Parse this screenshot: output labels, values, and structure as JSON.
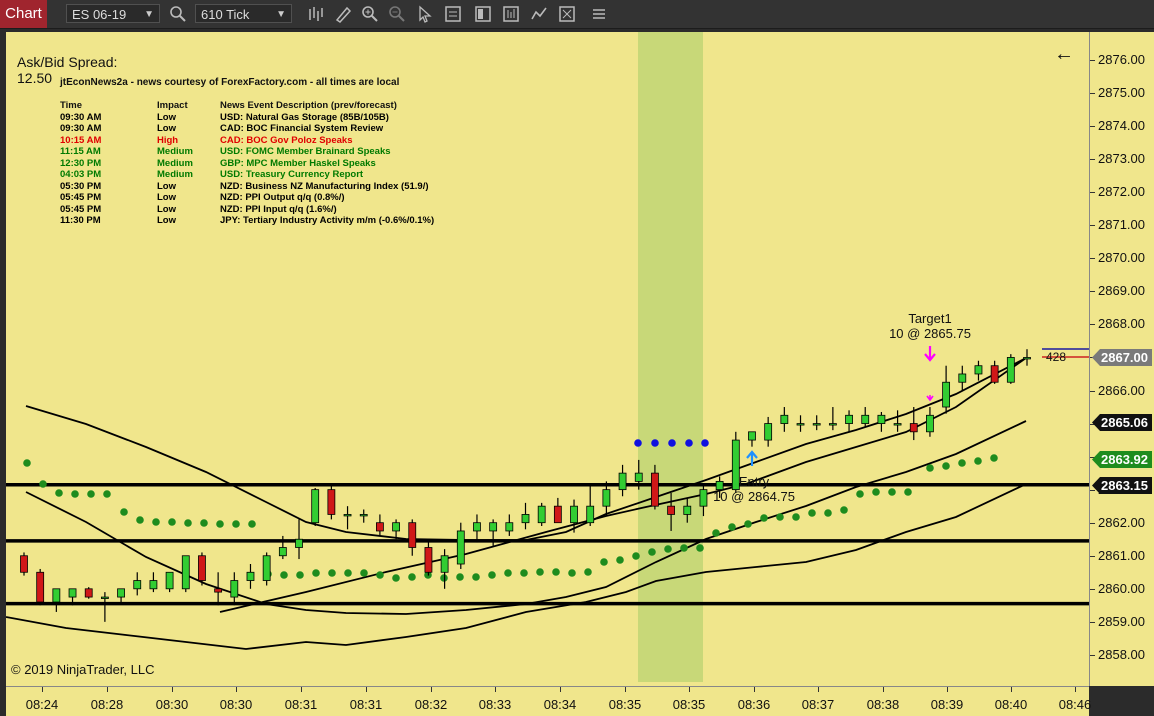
{
  "toolbar": {
    "tab_label": "Chart",
    "instrument": "ES 06-19",
    "interval": "610 Tick"
  },
  "spread": {
    "label": "Ask/Bid Spread:",
    "value": "12.50"
  },
  "news": {
    "title": "jtEconNews2a - news courtesy of ForexFactory.com - all times are local",
    "headers": [
      "Time",
      "Impact",
      "News Event Description (prev/forecast)"
    ],
    "rows": [
      {
        "time": "09:30 AM",
        "impact": "Low",
        "desc": "USD: Natural Gas Storage (85B/105B)",
        "color": "#000000"
      },
      {
        "time": "09:30 AM",
        "impact": "Low",
        "desc": "CAD: BOC Financial System Review",
        "color": "#000000"
      },
      {
        "time": "10:15 AM",
        "impact": "High",
        "desc": "CAD: BOC Gov Poloz Speaks",
        "color": "#e00000"
      },
      {
        "time": "11:15 AM",
        "impact": "Medium",
        "desc": "USD: FOMC Member Brainard Speaks",
        "color": "#007a00"
      },
      {
        "time": "12:30 PM",
        "impact": "Medium",
        "desc": "GBP: MPC Member Haskel Speaks",
        "color": "#007a00"
      },
      {
        "time": "04:03 PM",
        "impact": "Medium",
        "desc": "USD: Treasury Currency Report",
        "color": "#007a00"
      },
      {
        "time": "05:30 PM",
        "impact": "Low",
        "desc": "NZD: Business NZ Manufacturing Index (51.9/)",
        "color": "#000000"
      },
      {
        "time": "05:45 PM",
        "impact": "Low",
        "desc": "NZD: PPI Output q/q (0.8%/)",
        "color": "#000000"
      },
      {
        "time": "05:45 PM",
        "impact": "Low",
        "desc": "NZD: PPI Input q/q (1.6%/)",
        "color": "#000000"
      },
      {
        "time": "11:30 PM",
        "impact": "Low",
        "desc": "JPY: Tertiary Industry Activity m/m (-0.6%/0.1%)",
        "color": "#000000"
      }
    ]
  },
  "copyright": "© 2019 NinjaTrader, LLC",
  "annotations": {
    "target_label": "Target1",
    "target_detail": "10 @ 2865.75",
    "entry_label": "Entry",
    "entry_detail": "10 @ 2864.75",
    "position_qty": "428"
  },
  "price_axis": {
    "labels": [
      "2876.00",
      "2875.00",
      "2874.00",
      "2873.00",
      "2872.00",
      "2871.00",
      "2870.00",
      "2869.00",
      "2868.00",
      "2867.00",
      "2866.00",
      "2865.00",
      "2864.00",
      "2863.00",
      "2862.00",
      "2861.00",
      "2860.00",
      "2859.00",
      "2858.00"
    ],
    "boxes": [
      {
        "value": "2867.00",
        "bg": "#7a7a7a",
        "fg": "#ffffff"
      },
      {
        "value": "2865.06",
        "bg": "#111111",
        "fg": "#ffffff"
      },
      {
        "value": "2863.92",
        "bg": "#1e8c1e",
        "fg": "#ffffff"
      },
      {
        "value": "2863.15",
        "bg": "#111111",
        "fg": "#ffffff"
      }
    ]
  },
  "time_axis": {
    "labels": [
      "08:24",
      "08:28",
      "08:30",
      "08:30",
      "08:31",
      "08:31",
      "08:32",
      "08:33",
      "08:34",
      "08:35",
      "08:35",
      "08:36",
      "08:37",
      "08:38",
      "08:39",
      "08:40",
      "08:46"
    ]
  },
  "colors": {
    "background": "#f0e68c",
    "bull_candle": "#32cd32",
    "bear_candle": "#d01818",
    "dots": "#1e8c1e",
    "blue_dots": "#1010e0",
    "highlight": "#c8d878",
    "tab": "#a0252e"
  },
  "chart_data": {
    "type": "candlestick",
    "instrument": "ES 06-19",
    "interval": "610 Tick",
    "horizontal_lines": [
      2863.15,
      2861.45,
      2859.55
    ],
    "candles": [
      {
        "o": 2861.0,
        "h": 2861.1,
        "l": 2860.4,
        "c": 2860.5
      },
      {
        "o": 2860.5,
        "h": 2860.6,
        "l": 2859.5,
        "c": 2859.6
      },
      {
        "o": 2859.6,
        "h": 2860.0,
        "l": 2859.3,
        "c": 2860.0
      },
      {
        "o": 2859.75,
        "h": 2860.0,
        "l": 2859.5,
        "c": 2860.0
      },
      {
        "o": 2860.0,
        "h": 2860.05,
        "l": 2859.7,
        "c": 2859.75
      },
      {
        "o": 2859.75,
        "h": 2859.9,
        "l": 2859.0,
        "c": 2859.75
      },
      {
        "o": 2859.75,
        "h": 2860.0,
        "l": 2859.6,
        "c": 2860.0
      },
      {
        "o": 2860.0,
        "h": 2860.5,
        "l": 2859.8,
        "c": 2860.25
      },
      {
        "o": 2860.0,
        "h": 2860.5,
        "l": 2859.9,
        "c": 2860.25
      },
      {
        "o": 2860.0,
        "h": 2860.5,
        "l": 2859.9,
        "c": 2860.5
      },
      {
        "o": 2860.0,
        "h": 2861.0,
        "l": 2859.9,
        "c": 2861.0
      },
      {
        "o": 2861.0,
        "h": 2861.1,
        "l": 2860.1,
        "c": 2860.25
      },
      {
        "o": 2860.0,
        "h": 2860.5,
        "l": 2859.5,
        "c": 2859.9
      },
      {
        "o": 2859.75,
        "h": 2860.5,
        "l": 2859.5,
        "c": 2860.25
      },
      {
        "o": 2860.25,
        "h": 2860.75,
        "l": 2860.0,
        "c": 2860.5
      },
      {
        "o": 2860.25,
        "h": 2861.1,
        "l": 2860.1,
        "c": 2861.0
      },
      {
        "o": 2861.0,
        "h": 2861.6,
        "l": 2860.9,
        "c": 2861.25
      },
      {
        "o": 2861.25,
        "h": 2862.1,
        "l": 2860.9,
        "c": 2861.5
      },
      {
        "o": 2862.0,
        "h": 2863.05,
        "l": 2861.9,
        "c": 2863.0
      },
      {
        "o": 2863.0,
        "h": 2863.1,
        "l": 2862.1,
        "c": 2862.25
      },
      {
        "o": 2862.25,
        "h": 2862.5,
        "l": 2861.8,
        "c": 2862.25
      },
      {
        "o": 2862.25,
        "h": 2862.4,
        "l": 2862.0,
        "c": 2862.25
      },
      {
        "o": 2862.0,
        "h": 2862.25,
        "l": 2861.6,
        "c": 2861.75
      },
      {
        "o": 2861.75,
        "h": 2862.1,
        "l": 2861.5,
        "c": 2862.0
      },
      {
        "o": 2862.0,
        "h": 2862.1,
        "l": 2861.0,
        "c": 2861.25
      },
      {
        "o": 2861.25,
        "h": 2861.5,
        "l": 2860.4,
        "c": 2860.5
      },
      {
        "o": 2860.5,
        "h": 2861.2,
        "l": 2860.0,
        "c": 2861.0
      },
      {
        "o": 2860.75,
        "h": 2862.0,
        "l": 2860.6,
        "c": 2861.75
      },
      {
        "o": 2861.75,
        "h": 2862.25,
        "l": 2861.4,
        "c": 2862.0
      },
      {
        "o": 2861.75,
        "h": 2862.1,
        "l": 2861.3,
        "c": 2862.0
      },
      {
        "o": 2861.75,
        "h": 2862.25,
        "l": 2861.6,
        "c": 2862.0
      },
      {
        "o": 2862.0,
        "h": 2862.6,
        "l": 2861.8,
        "c": 2862.25
      },
      {
        "o": 2862.0,
        "h": 2862.6,
        "l": 2861.9,
        "c": 2862.5
      },
      {
        "o": 2862.5,
        "h": 2862.75,
        "l": 2862.0,
        "c": 2862.0
      },
      {
        "o": 2862.0,
        "h": 2862.7,
        "l": 2861.7,
        "c": 2862.5
      },
      {
        "o": 2862.0,
        "h": 2863.1,
        "l": 2861.9,
        "c": 2862.5
      },
      {
        "o": 2862.5,
        "h": 2863.25,
        "l": 2862.2,
        "c": 2863.0
      },
      {
        "o": 2863.0,
        "h": 2863.75,
        "l": 2862.8,
        "c": 2863.5
      },
      {
        "o": 2863.25,
        "h": 2863.9,
        "l": 2863.0,
        "c": 2863.5
      },
      {
        "o": 2863.5,
        "h": 2863.75,
        "l": 2862.4,
        "c": 2862.5
      },
      {
        "o": 2862.5,
        "h": 2862.9,
        "l": 2861.75,
        "c": 2862.25
      },
      {
        "o": 2862.25,
        "h": 2862.75,
        "l": 2862.0,
        "c": 2862.5
      },
      {
        "o": 2862.5,
        "h": 2863.1,
        "l": 2862.2,
        "c": 2863.0
      },
      {
        "o": 2863.0,
        "h": 2863.4,
        "l": 2862.75,
        "c": 2863.25
      },
      {
        "o": 2863.0,
        "h": 2864.75,
        "l": 2862.9,
        "c": 2864.5
      },
      {
        "o": 2864.5,
        "h": 2864.75,
        "l": 2864.3,
        "c": 2864.75
      },
      {
        "o": 2864.5,
        "h": 2865.2,
        "l": 2864.3,
        "c": 2865.0
      },
      {
        "o": 2865.0,
        "h": 2865.5,
        "l": 2864.75,
        "c": 2865.25
      },
      {
        "o": 2865.0,
        "h": 2865.25,
        "l": 2864.75,
        "c": 2865.0
      },
      {
        "o": 2865.0,
        "h": 2865.25,
        "l": 2864.8,
        "c": 2865.0
      },
      {
        "o": 2865.0,
        "h": 2865.5,
        "l": 2864.8,
        "c": 2865.0
      },
      {
        "o": 2865.0,
        "h": 2865.4,
        "l": 2864.75,
        "c": 2865.25
      },
      {
        "o": 2865.0,
        "h": 2865.5,
        "l": 2864.9,
        "c": 2865.25
      },
      {
        "o": 2865.0,
        "h": 2865.35,
        "l": 2864.75,
        "c": 2865.25
      },
      {
        "o": 2865.0,
        "h": 2865.4,
        "l": 2864.75,
        "c": 2865.0
      },
      {
        "o": 2865.0,
        "h": 2865.5,
        "l": 2864.5,
        "c": 2864.75
      },
      {
        "o": 2864.75,
        "h": 2865.5,
        "l": 2864.6,
        "c": 2865.25
      },
      {
        "o": 2865.5,
        "h": 2866.75,
        "l": 2865.3,
        "c": 2866.25
      },
      {
        "o": 2866.25,
        "h": 2866.75,
        "l": 2866.0,
        "c": 2866.5
      },
      {
        "o": 2866.5,
        "h": 2866.9,
        "l": 2866.3,
        "c": 2866.75
      },
      {
        "o": 2866.75,
        "h": 2866.9,
        "l": 2866.2,
        "c": 2866.25
      },
      {
        "o": 2866.25,
        "h": 2867.1,
        "l": 2866.2,
        "c": 2867.0
      },
      {
        "o": 2867.0,
        "h": 2867.25,
        "l": 2866.75,
        "c": 2867.0
      }
    ]
  }
}
